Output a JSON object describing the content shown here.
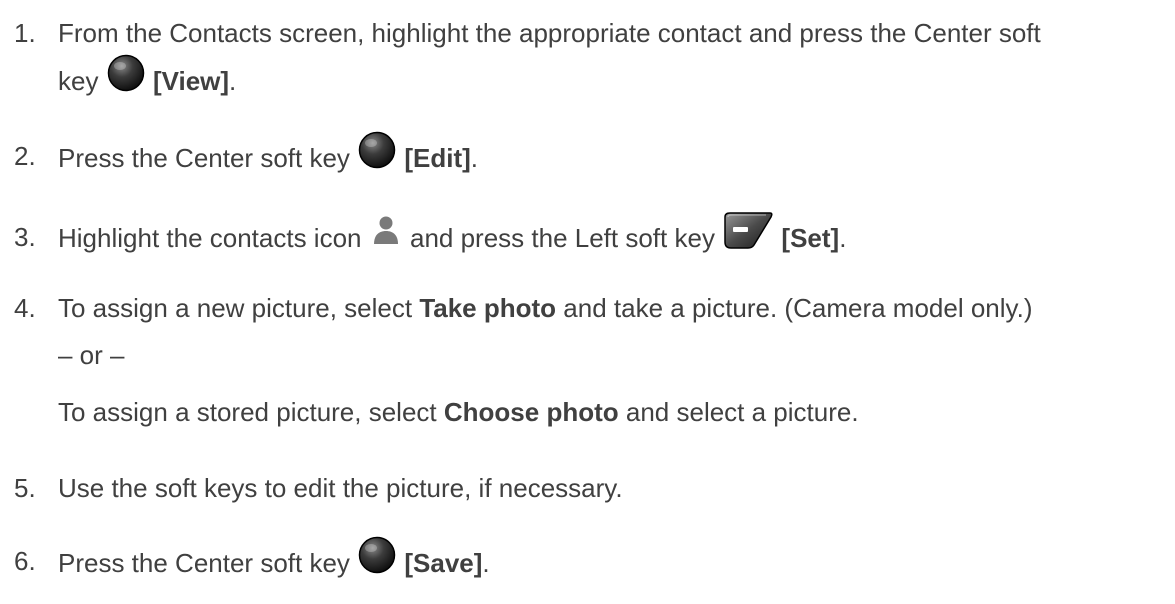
{
  "steps": [
    {
      "number": "1.",
      "line1": "From the Contacts screen, highlight the appropriate contact and press the Center soft",
      "line2_pre": "key",
      "key_label": "[View]",
      "line2_post": "."
    },
    {
      "number": "2.",
      "pre": "Press the Center soft key",
      "key_label": "[Edit]",
      "post": "."
    },
    {
      "number": "3.",
      "pre": "Highlight the contacts icon",
      "mid": "and press the Left soft key",
      "key_label": "[Set]",
      "post": "."
    },
    {
      "number": "4.",
      "pre": "To assign a new picture, select",
      "bold": "Take photo",
      "post": "and take a picture. (Camera model only.)",
      "or_text": "– or –",
      "alt_pre": "To assign a stored picture, select",
      "alt_bold": "Choose photo",
      "alt_post": "and select a picture."
    },
    {
      "number": "5.",
      "text": "Use the soft keys to edit the picture, if necessary."
    },
    {
      "number": "6.",
      "pre": "Press the Center soft key",
      "key_label": "[Save]",
      "post": "."
    }
  ],
  "icons": {
    "center_key": "center-soft-key-icon",
    "left_key": "left-soft-key-icon",
    "contacts": "contacts-person-icon"
  }
}
